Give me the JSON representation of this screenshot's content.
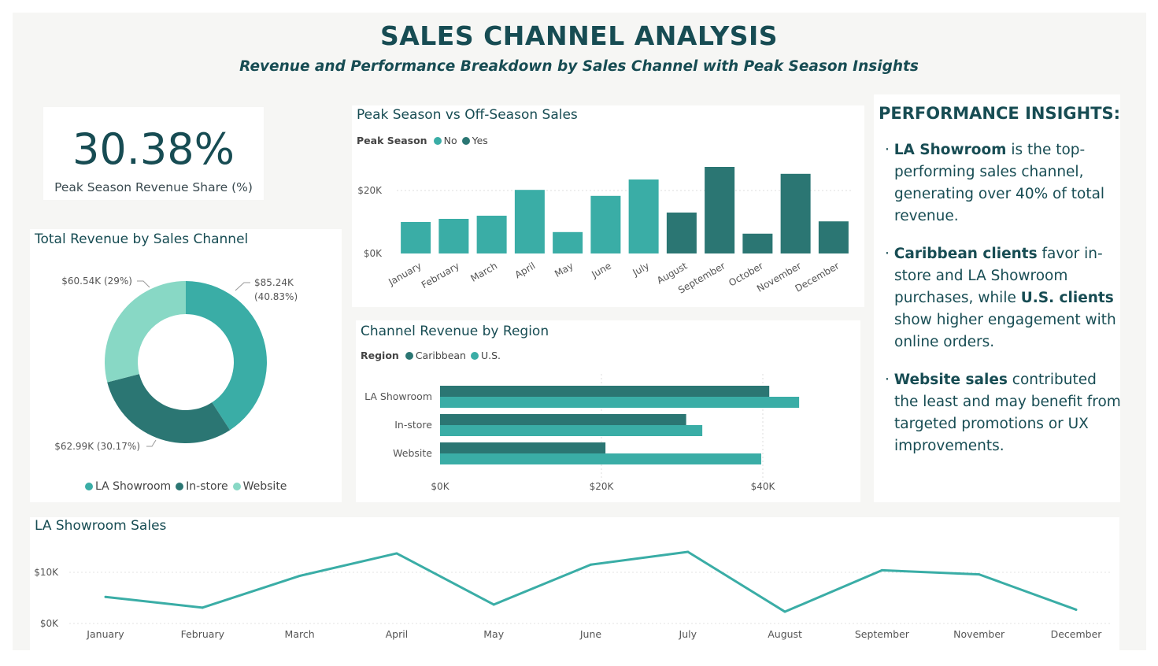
{
  "header": {
    "title": "SALES CHANNEL ANALYSIS",
    "subtitle": "Revenue and Performance Breakdown by Sales Channel with Peak Season Insights"
  },
  "colors": {
    "la_showroom": "#3aada6",
    "in_store": "#2b7673",
    "website": "#88d8c5",
    "peak_no": "#3aada6",
    "peak_yes": "#2b7673",
    "caribbean": "#2b7673",
    "us": "#3aada6",
    "text": "#174c53"
  },
  "kpi": {
    "value": "30.38%",
    "label": "Peak Season Revenue Share (%)"
  },
  "donut": {
    "title": "Total Revenue by Sales Channel",
    "legend": [
      "LA Showroom",
      "In-store",
      "Website"
    ]
  },
  "peak": {
    "title": "Peak Season vs Off-Season Sales",
    "legend_title": "Peak Season",
    "legend": [
      "No",
      "Yes"
    ]
  },
  "region": {
    "title": "Channel Revenue by Region",
    "legend_title": "Region",
    "legend": [
      "Caribbean",
      "U.S."
    ]
  },
  "line": {
    "title": "LA Showroom Sales"
  },
  "insights": {
    "title": "PERFORMANCE INSIGHTS:",
    "items": [
      {
        "bold": "LA Showroom",
        "rest": " is the top-performing sales channel, generating over 40% of total revenue."
      },
      {
        "bold": "Caribbean clients",
        "rest": " favor in-store and LA Showroom purchases, while ",
        "bold2": "U.S. clients",
        "rest2": " show higher engagement with online orders."
      },
      {
        "bold": "Website sales",
        "rest": " contributed the least and may benefit from targeted promotions or UX improvements."
      }
    ]
  },
  "chart_data": [
    {
      "id": "donut",
      "type": "pie",
      "title": "Total Revenue by Sales Channel",
      "categories": [
        "LA Showroom",
        "In-store",
        "Website"
      ],
      "values": [
        85240,
        62990,
        60540
      ],
      "labels": [
        "$85.24K (40.83%)",
        "$62.99K (30.17%)",
        "$60.54K (29%)"
      ]
    },
    {
      "id": "peak",
      "type": "bar",
      "title": "Peak Season vs Off-Season Sales",
      "categories": [
        "January",
        "February",
        "March",
        "April",
        "May",
        "June",
        "July",
        "August",
        "September",
        "October",
        "November",
        "December"
      ],
      "values": [
        10000,
        11000,
        12000,
        20200,
        6800,
        18300,
        23500,
        13000,
        27500,
        6300,
        25300,
        10200
      ],
      "peak_season": [
        "No",
        "No",
        "No",
        "No",
        "No",
        "No",
        "No",
        "Yes",
        "Yes",
        "Yes",
        "Yes",
        "Yes"
      ],
      "yticks": [
        "$0K",
        "$20K"
      ],
      "ylim": [
        0,
        30000
      ]
    },
    {
      "id": "region",
      "type": "bar",
      "orientation": "horizontal",
      "title": "Channel Revenue by Region",
      "categories": [
        "LA Showroom",
        "In-store",
        "Website"
      ],
      "series": [
        {
          "name": "Caribbean",
          "values": [
            40800,
            30500,
            20500
          ]
        },
        {
          "name": "U.S.",
          "values": [
            44500,
            32500,
            39800
          ]
        }
      ],
      "xticks": [
        "$0K",
        "$20K",
        "$40K"
      ],
      "xlim": [
        0,
        50000
      ]
    },
    {
      "id": "line",
      "type": "line",
      "title": "LA Showroom Sales",
      "x": [
        "January",
        "February",
        "March",
        "April",
        "May",
        "June",
        "July",
        "August",
        "September",
        "November",
        "December"
      ],
      "values": [
        5200,
        3100,
        9300,
        13700,
        3700,
        11500,
        14000,
        2300,
        10400,
        9600,
        2700
      ],
      "yticks": [
        "$0K",
        "$10K"
      ],
      "ylim": [
        0,
        15000
      ]
    }
  ]
}
